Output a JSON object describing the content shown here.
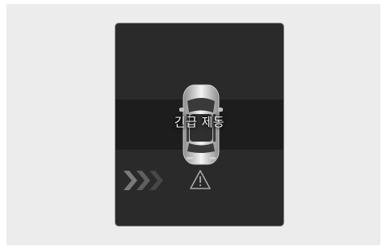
{
  "alert": {
    "text": "긴급 제동"
  },
  "icons": {
    "vehicle": "car-top-view-icon",
    "approach": "approach-arrows-icon",
    "warning": "warning-triangle-icon"
  },
  "colors": {
    "screen_bg": "#2a2a2a",
    "band_bg": "#1d1d1d",
    "text": "#f2f2f2"
  }
}
